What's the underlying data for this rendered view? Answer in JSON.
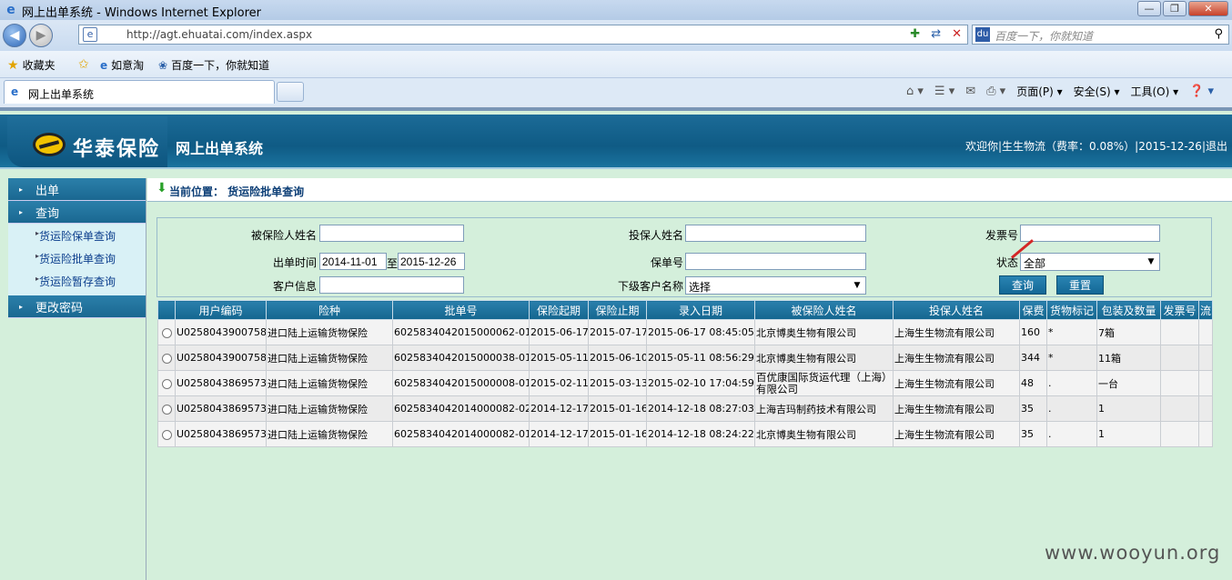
{
  "browser": {
    "window_title": "网上出单系统 - Windows Internet Explorer",
    "url": "http://agt.ehuatai.com/index.aspx",
    "search_placeholder": "百度一下，你就知道",
    "favorites": {
      "label": "收藏夹",
      "items": [
        "如意淘",
        "百度一下，你就知道"
      ]
    },
    "tab_title": "网上出单系统",
    "commands": {
      "page": "页面(P)",
      "safety": "安全(S)",
      "tools": "工具(O)"
    }
  },
  "header": {
    "logo_text": "华泰保险",
    "system_name": "网上出单系统",
    "welcome": "欢迎你|生生物流（费率：0.08%）|2015-12-26|退出"
  },
  "sidebar": {
    "menus": [
      {
        "label": "出单"
      },
      {
        "label": "查询",
        "items": [
          "货运险保单查询",
          "货运险批单查询",
          "货运险暂存查询"
        ]
      },
      {
        "label": "更改密码"
      }
    ]
  },
  "breadcrumb": {
    "text": "当前位置：  货运险批单查询"
  },
  "form": {
    "insured_name_label": "被保险人姓名",
    "insured_name_value": "",
    "applicant_name_label": "投保人姓名",
    "applicant_name_value": "",
    "invoice_label": "发票号",
    "invoice_value": "",
    "date_label": "出单时间",
    "date_from": "2014-11-01",
    "date_sep": "至",
    "date_to": "2015-12-26",
    "policy_no_label": "保单号",
    "policy_no_value": "",
    "status_label": "状态",
    "status_value": "全部",
    "customer_info_label": "客户信息",
    "customer_info_value": "",
    "sub_customer_label": "下级客户名称",
    "sub_customer_value": "选择",
    "query_button": "查询",
    "reset_button": "重置"
  },
  "table": {
    "headers": [
      "",
      "用户编码",
      "险种",
      "批单号",
      "保险起期",
      "保险止期",
      "录入日期",
      "被保险人姓名",
      "投保人姓名",
      "保费",
      "货物标记",
      "包装及数量",
      "发票号",
      "流"
    ],
    "rows": [
      [
        "U0258043900758",
        "进口陆上运输货物保险",
        "6025834042015000062-01",
        "2015-06-17",
        "2015-07-17",
        "2015-06-17 08:45:05",
        "北京博奥生物有限公司",
        "上海生生物流有限公司",
        "160",
        "*",
        "7箱",
        "",
        ""
      ],
      [
        "U0258043900758",
        "进口陆上运输货物保险",
        "6025834042015000038-01",
        "2015-05-11",
        "2015-06-10",
        "2015-05-11 08:56:29",
        "北京博奥生物有限公司",
        "上海生生物流有限公司",
        "344",
        "*",
        "11箱",
        "",
        ""
      ],
      [
        "U0258043869573",
        "进口陆上运输货物保险",
        "6025834042015000008-01",
        "2015-02-11",
        "2015-03-13",
        "2015-02-10 17:04:59",
        "百优康国际货运代理（上海）有限公司",
        "上海生生物流有限公司",
        "48",
        ".",
        "一台",
        "",
        ""
      ],
      [
        "U0258043869573",
        "进口陆上运输货物保险",
        "6025834042014000082-02",
        "2014-12-17",
        "2015-01-16",
        "2014-12-18 08:27:03",
        "上海吉玛制药技术有限公司",
        "上海生生物流有限公司",
        "35",
        ".",
        "1",
        "",
        ""
      ],
      [
        "U0258043869573",
        "进口陆上运输货物保险",
        "6025834042014000082-01",
        "2014-12-17",
        "2015-01-16",
        "2014-12-18 08:24:22",
        "北京博奥生物有限公司",
        "上海生生物流有限公司",
        "35",
        ".",
        "1",
        "",
        ""
      ]
    ]
  },
  "watermark": "www.wooyun.org"
}
